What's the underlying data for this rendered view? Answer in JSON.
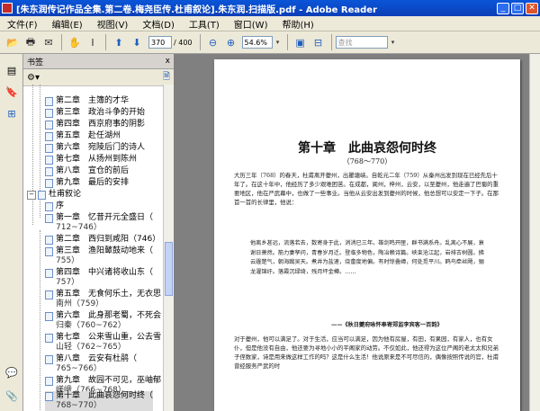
{
  "window": {
    "title": "[朱东润传记作品全集.第二卷.梅尧臣传.杜甫叙论].朱东润.扫描版.pdf - Adobe Reader",
    "minimize": "_",
    "maximize": "□",
    "close": "✕"
  },
  "menu": [
    "文件(F)",
    "编辑(E)",
    "视图(V)",
    "文档(D)",
    "工具(T)",
    "窗口(W)",
    "帮助(H)"
  ],
  "toolbar": {
    "page_number": "370",
    "page_total": "/ 400",
    "zoom": "54.6%",
    "search_placeholder": "查找"
  },
  "panel": {
    "header": "书签",
    "close_glyph": "x"
  },
  "bookmarks": {
    "section_label": "杜甫叙论",
    "section_toggle": "−",
    "before": [
      {
        "label": "第二章　主簿的才华"
      },
      {
        "label": "第三章　政治斗争的开始"
      },
      {
        "label": "第四章　西京府事的阴影"
      },
      {
        "label": "第五章　赴任湖州"
      },
      {
        "label": "第六章　宛陵后门的诗人"
      },
      {
        "label": "第七章　从扬州到陈州"
      },
      {
        "label": "第八章　宣仓的前后"
      },
      {
        "label": "第九章　最后的安排"
      }
    ],
    "items": [
      {
        "label": "序",
        "sub": ""
      },
      {
        "label": "第一章　忆昔开元全盛日（",
        "sub": "712~746）"
      },
      {
        "label": "第二章　西归到咸阳（746）",
        "sub": ""
      },
      {
        "label": "第三章　渔阳鼙鼓动地来（",
        "sub": "755）"
      },
      {
        "label": "第四章　中兴诸将收山东（",
        "sub": "757）"
      },
      {
        "label": "第五章　无食何乐土，无衣思",
        "sub": "南州（759）"
      },
      {
        "label": "第六章　此身那老蜀，不死会",
        "sub": "归秦（760~762）"
      },
      {
        "label": "第七章　公来雪山重，公去雪",
        "sub": "山轻（762~765）"
      },
      {
        "label": "第八章　云安有杜鹃（",
        "sub": "765~766）"
      },
      {
        "label": "第九章　故园不可见，巫岫郁",
        "sub": "嵯峨（766~768）"
      },
      {
        "label": "第十章　此曲哀怨何时终（",
        "sub": "768~770）"
      }
    ]
  },
  "page": {
    "chapter_title": "第十章　此曲哀怨何时终",
    "chapter_years": "（768～770）",
    "para1": "大历三年（768）的春天，杜甫离开夔州，出瞿塘峡。自乾元二年（759）从秦州出发到现在已经先后十年了。在这十年中，他经历了多少艰难困苦。在成都，阆州，梓州，云安，以至夔州，他走遍了巴蜀的重要地区，他在严武幕中，也做了一些事业。当他从云安出发到夔州的时候，他总想可以安定一下子。在那首一首的长律里，他说：",
    "quote": "他离乡甚远，流落若去，数寄身于此，消消已三年。雄剑鸣开匣，群书满系舟。乱离心不展，衰谢日萧然。筋力妻孥问，青春岁月迁。登临多物色，陶冶赖诗篇。峡束沧江起，岩排古树圆。拂云霾楚气，朝海蹴吴天。煮井为盐速，烧畬度地偏。有时惊叠嶂，何处觅平川。鸥鸟牵丝飏，骊龙濯锦纡。落霞沉绿绮，残月坏金樽。……",
    "citation": "——《秋日夔府咏怀奉寄郑监李宾客一百韵》",
    "para2": "对于夔州，他可以满足了。对于生活，应当可以满足，因为他有房屋，有田，有果园，有家人，也有女仆，但是他没有自由，他还要为寻地小小的平阁家的动劳。不仅如此，他还得为这位严阁的老太太和兄弟子侄数家，诗是用来做这样工作的吗？这是什么生活！他说原来是不可尽信的，偶像按照传说的官，杜甫曾经服务严武的时"
  }
}
